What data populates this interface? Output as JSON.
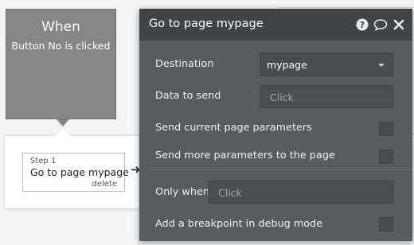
{
  "event_card": {
    "title": "When",
    "subtitle": "Button No is clicked"
  },
  "step": {
    "number_label": "Step 1",
    "title": "Go to page mypage",
    "delete_label": "delete"
  },
  "panel": {
    "title": "Go to page mypage",
    "icons": [
      "help-icon",
      "comment-icon",
      "close-icon"
    ],
    "destination": {
      "label": "Destination",
      "value": "mypage"
    },
    "data_to_send": {
      "label": "Data to send",
      "placeholder": "Click"
    },
    "send_current_params": {
      "label": "Send current page parameters",
      "checked": false
    },
    "send_more_params": {
      "label": "Send more parameters to the page",
      "checked": false
    },
    "only_when": {
      "label": "Only when",
      "placeholder": "Click"
    },
    "breakpoint": {
      "label": "Add a breakpoint in debug mode",
      "checked": false
    }
  },
  "colors": {
    "panel_bg": "#565c5f",
    "header_bg": "#3f4447",
    "event_card_bg": "#868686",
    "canvas_bg": "#f4f4f4"
  }
}
